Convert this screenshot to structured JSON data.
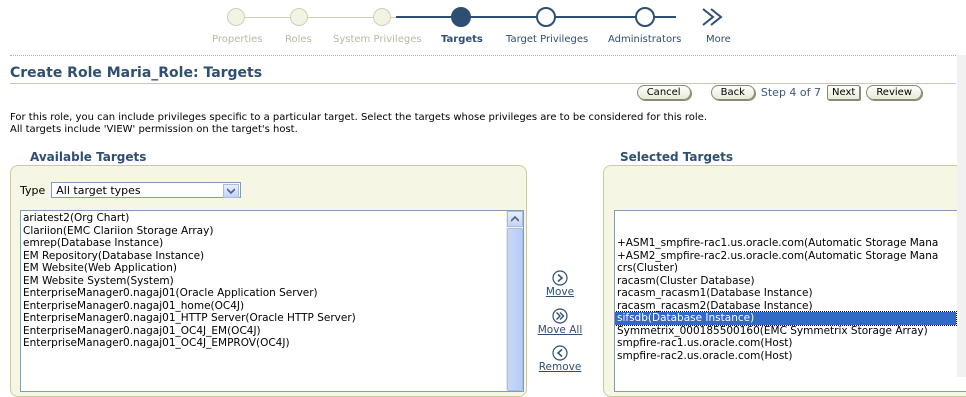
{
  "train": {
    "steps": [
      {
        "label": "Properties",
        "state": "done"
      },
      {
        "label": "Roles",
        "state": "done"
      },
      {
        "label": "System Privileges",
        "state": "done"
      },
      {
        "label": "Targets",
        "state": "current"
      },
      {
        "label": "Target Privileges",
        "state": "next"
      },
      {
        "label": "Administrators",
        "state": "next"
      },
      {
        "label": "More",
        "state": "more"
      }
    ]
  },
  "page": {
    "title": "Create Role Maria_Role: Targets",
    "info_line1": "For this role, you can include privileges specific to a particular target. Select the targets whose privileges are to be considered for this role.",
    "info_line2": "All targets include 'VIEW' permission on the target's host."
  },
  "buttons": {
    "cancel": "Cancel",
    "back": "Back",
    "step": "Step 4 of 7",
    "next": "Next",
    "review": "Review"
  },
  "available": {
    "heading": "Available Targets",
    "type_label": "Type",
    "type_value": "All target types",
    "items": [
      "ariatest2(Org Chart)",
      "Clariion(EMC Clariion Storage Array)",
      "emrep(Database Instance)",
      "EM Repository(Database Instance)",
      "EM Website(Web Application)",
      "EM Website System(System)",
      "EnterpriseManager0.nagaj01(Oracle Application Server)",
      "EnterpriseManager0.nagaj01_home(OC4J)",
      "EnterpriseManager0.nagaj01_HTTP Server(Oracle HTTP Server)",
      "EnterpriseManager0.nagaj01_OC4J_EM(OC4J)",
      "EnterpriseManager0.nagaj01_OC4J_EMPROV(OC4J)"
    ]
  },
  "shuttle": {
    "move": "Move",
    "move_all": "Move All",
    "remove": "Remove"
  },
  "selected": {
    "heading": "Selected Targets",
    "selected_index": 6,
    "items": [
      "+ASM1_smpfire-rac1.us.oracle.com(Automatic Storage Mana",
      "+ASM2_smpfire-rac2.us.oracle.com(Automatic Storage Mana",
      "crs(Cluster)",
      "racasm(Cluster Database)",
      "racasm_racasm1(Database Instance)",
      "racasm_racasm2(Database Instance)",
      "sifsdb(Database Instance)",
      "Symmetrix_000185500160(EMC Symmetrix Storage Array)",
      "smpfire-rac1.us.oracle.com(Host)",
      "smpfire-rac2.us.oracle.com(Host)"
    ]
  },
  "colors": {
    "accent": "#2f4f72",
    "panel": "#f6f6e4",
    "selection": "#316ac5"
  }
}
